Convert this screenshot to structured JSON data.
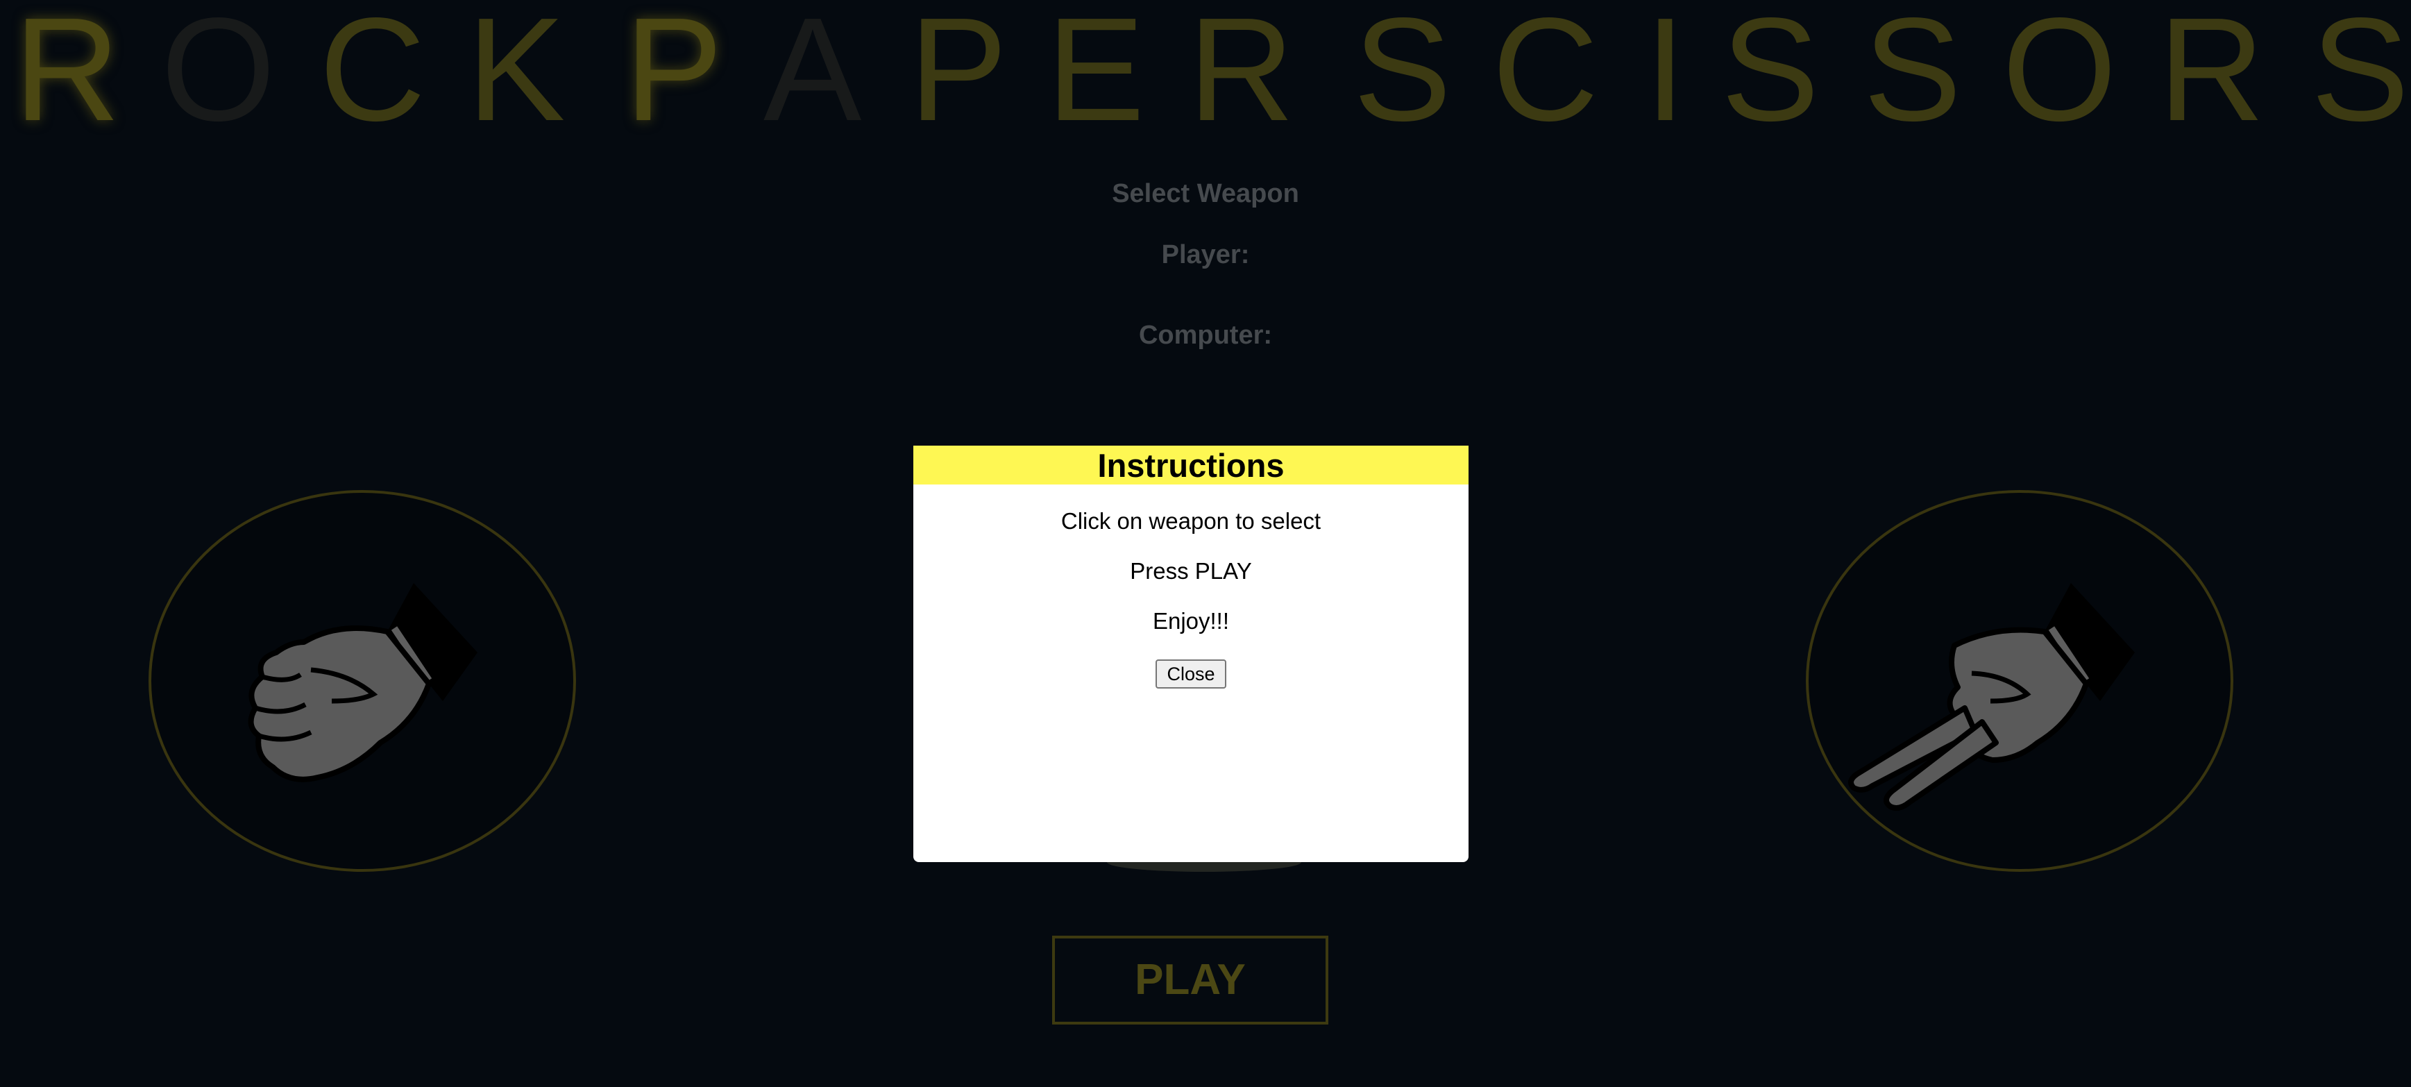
{
  "title": {
    "letters": [
      "R",
      "O",
      "C",
      "K",
      "P",
      "A",
      "P",
      "E",
      "R",
      "S",
      "C",
      "I",
      "S",
      "S",
      "O",
      "R",
      "S"
    ]
  },
  "status": {
    "select_weapon": "Select Weapon",
    "player_label": "Player:",
    "computer_label": "Computer:"
  },
  "weapons": {
    "rock": {
      "name": "rock"
    },
    "scissors": {
      "name": "scissors"
    }
  },
  "play_button": {
    "label": "PLAY"
  },
  "modal": {
    "title": "Instructions",
    "lines": [
      "Click on weapon to select",
      "Press PLAY",
      "Enjoy!!!"
    ],
    "close_label": "Close"
  },
  "colors": {
    "background": "#050a10",
    "accent_yellow": "#fef753",
    "dim_gold": "#3d3a10",
    "hand_fill": "#5a5a5a"
  }
}
